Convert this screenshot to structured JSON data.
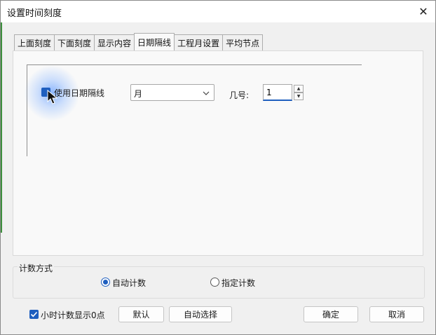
{
  "window": {
    "title": "设置时间刻度",
    "close_glyph": "✕"
  },
  "tabs": [
    {
      "label": "上面刻度"
    },
    {
      "label": "下面刻度"
    },
    {
      "label": "显示内容"
    },
    {
      "label": "日期隔线"
    },
    {
      "label": "工程月设置"
    },
    {
      "label": "平均节点"
    }
  ],
  "active_tab_index": 3,
  "date_line": {
    "use_label": "使用日期隔线",
    "use_checked": true,
    "unit_value": "月",
    "day_label": "几号:",
    "day_value": "1"
  },
  "count_method": {
    "legend": "计数方式",
    "options": [
      {
        "label": "自动计数",
        "selected": true
      },
      {
        "label": "指定计数",
        "selected": false
      }
    ]
  },
  "footer": {
    "hour_zero_label": "小时计数显示0点",
    "hour_zero_checked": true,
    "default_btn": "默认",
    "auto_select_btn": "自动选择",
    "ok_btn": "确定",
    "cancel_btn": "取消"
  },
  "colors": {
    "accent": "#1f5fbf",
    "panel": "#f9f9f9",
    "dialog": "#f0f0f0"
  },
  "icons": {
    "close": "close-icon",
    "dropdown": "chevron-down-icon",
    "cursor": "mouse-pointer-icon"
  }
}
